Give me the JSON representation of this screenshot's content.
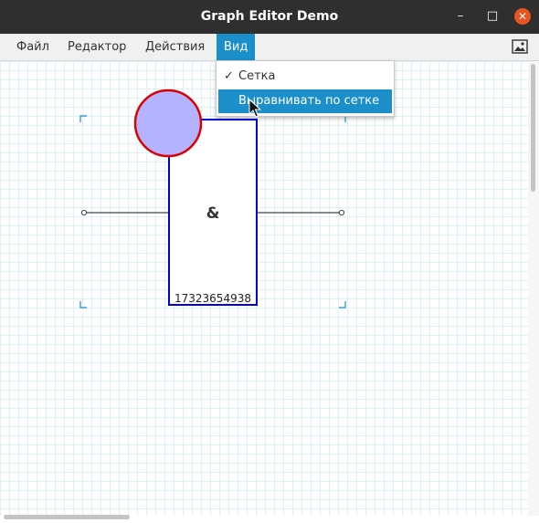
{
  "window": {
    "title": "Graph Editor Demo"
  },
  "menubar": {
    "items": [
      {
        "label": "Файл"
      },
      {
        "label": "Редактор"
      },
      {
        "label": "Действия"
      },
      {
        "label": "Вид"
      }
    ],
    "image_icon": "image-icon"
  },
  "view_menu": {
    "items": [
      {
        "label": "Сетка",
        "checked": true,
        "check_mark": "✓"
      },
      {
        "label": "Выравнивать по сетке",
        "highlighted": true
      }
    ]
  },
  "diagram": {
    "gate_symbol": "&",
    "gate_label": "17323654938",
    "colors": {
      "gate_border": "#0000dd",
      "circle_fill": "#b3b3ff",
      "circle_border": "#dd0000",
      "selection_handles": "#1a8fc9",
      "accent": "#1a8fc9"
    }
  }
}
